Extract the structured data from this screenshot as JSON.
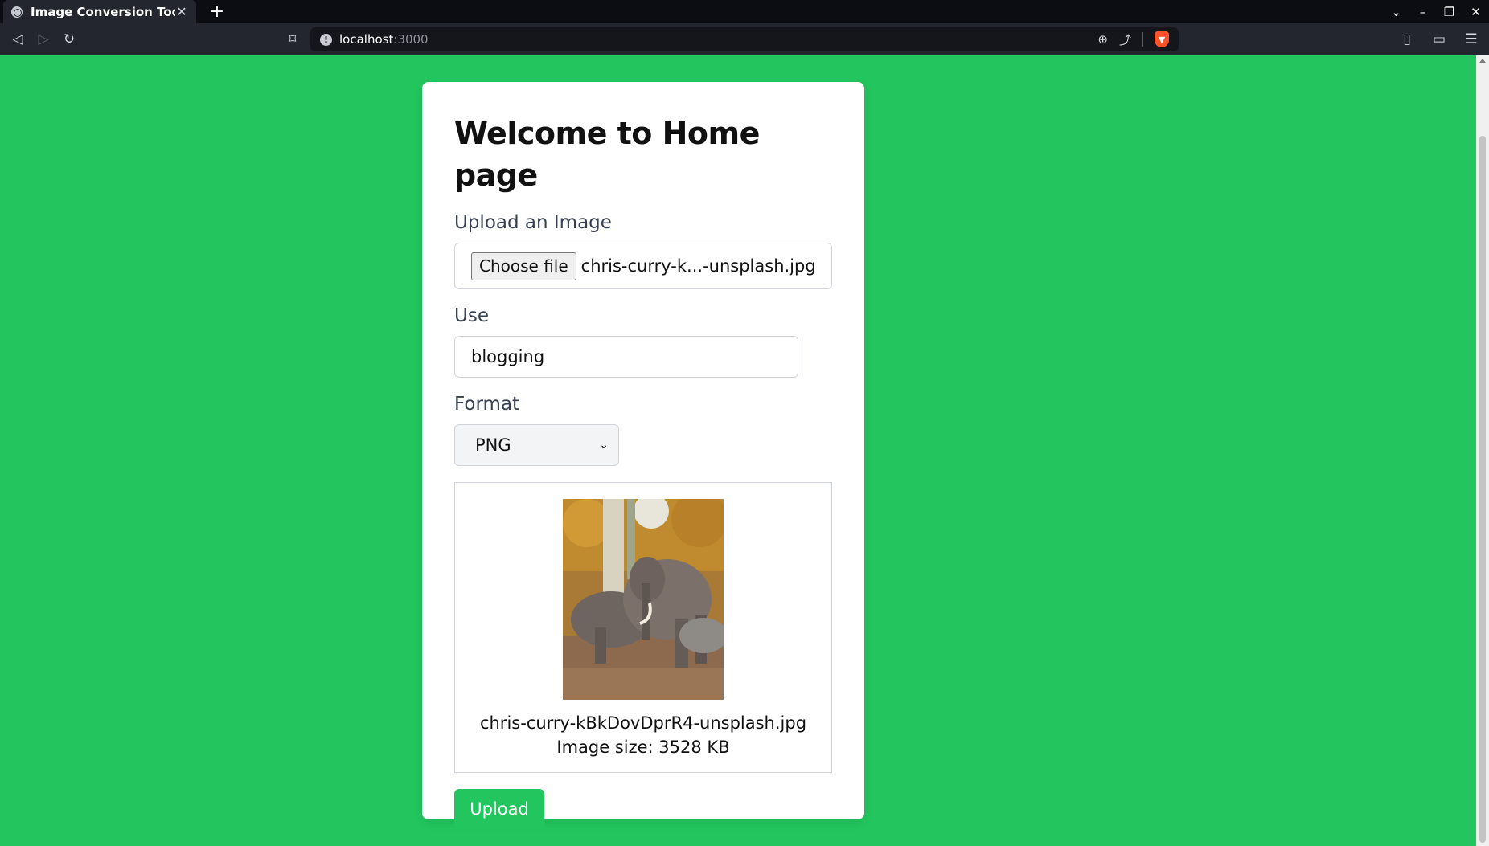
{
  "browser": {
    "tab_title": "Image Conversion Tool",
    "url_host": "localhost",
    "url_port": ":3000"
  },
  "page": {
    "title": "Welcome to Home page",
    "upload_label": "Upload an Image",
    "choose_file_label": "Choose file",
    "chosen_file_name": "chris-curry-k...-unsplash.jpg",
    "use_label": "Use",
    "use_value": "blogging",
    "format_label": "Format",
    "format_value": "PNG",
    "preview_filename": "chris-curry-kBkDovDprR4-unsplash.jpg",
    "preview_size": "Image size: 3528 KB",
    "upload_button": "Upload"
  },
  "colors": {
    "background": "#22c55e",
    "button": "#22c55e",
    "card": "#ffffff"
  },
  "icons": {
    "preview_image": "elephants-photo"
  }
}
